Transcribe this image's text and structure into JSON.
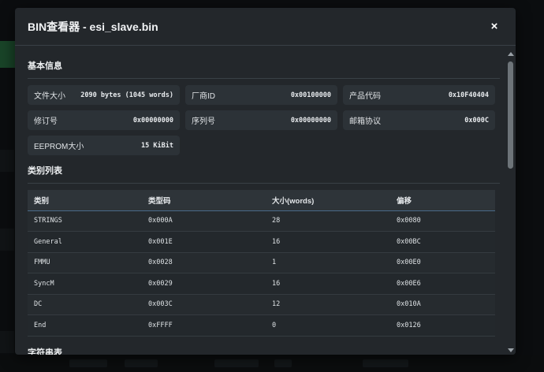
{
  "modal": {
    "title": "BIN查看器 - esi_slave.bin",
    "close_icon": "×"
  },
  "basic_info": {
    "title": "基本信息",
    "items": [
      {
        "label": "文件大小",
        "value": "2090 bytes (1045 words)"
      },
      {
        "label": "厂商ID",
        "value": "0x00100000"
      },
      {
        "label": "产品代码",
        "value": "0x10F40404"
      },
      {
        "label": "修订号",
        "value": "0x00000000"
      },
      {
        "label": "序列号",
        "value": "0x00000000"
      },
      {
        "label": "邮箱协议",
        "value": "0x000C"
      },
      {
        "label": "EEPROM大小",
        "value": "15 KiBit"
      }
    ]
  },
  "categories": {
    "title": "类别列表",
    "headers": [
      "类别",
      "类型码",
      "大小(words)",
      "偏移"
    ],
    "rows": [
      [
        "STRINGS",
        "0x000A",
        "28",
        "0x0080"
      ],
      [
        "General",
        "0x001E",
        "16",
        "0x00BC"
      ],
      [
        "FMMU",
        "0x0028",
        "1",
        "0x00E0"
      ],
      [
        "SyncM",
        "0x0029",
        "16",
        "0x00E6"
      ],
      [
        "DC",
        "0x003C",
        "12",
        "0x010A"
      ],
      [
        "End",
        "0xFFFF",
        "0",
        "0x0126"
      ]
    ]
  },
  "strings": {
    "title": "字符串表"
  }
}
